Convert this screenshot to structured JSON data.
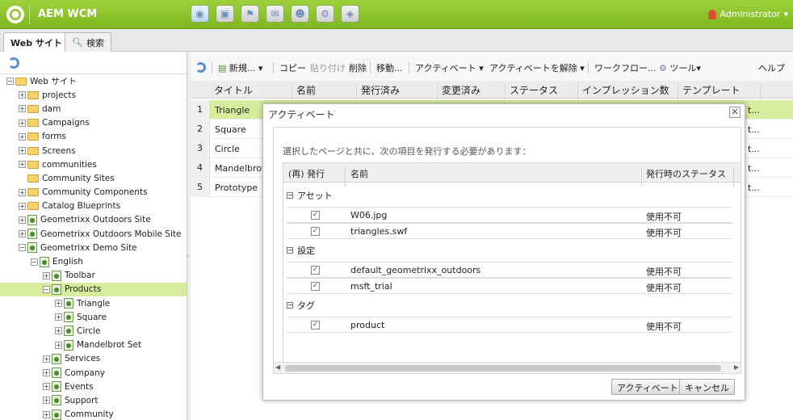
{
  "app": {
    "title": "AEM WCM",
    "user": "Administrator"
  },
  "nav_icons": [
    "websites-icon",
    "assets-icon",
    "campaigns-icon",
    "inbox-icon",
    "users-icon",
    "tools-icon",
    "tagging-icon"
  ],
  "tabs": [
    {
      "label": "Web サイト"
    },
    {
      "label": "検索"
    }
  ],
  "tree": [
    {
      "label": "Web サイト",
      "indent": 0,
      "exp": "−",
      "icon": "folder"
    },
    {
      "label": "projects",
      "indent": 1,
      "exp": "+",
      "icon": "folder"
    },
    {
      "label": "dam",
      "indent": 1,
      "exp": "+",
      "icon": "folder"
    },
    {
      "label": "Campaigns",
      "indent": 1,
      "exp": "+",
      "icon": "folder"
    },
    {
      "label": "forms",
      "indent": 1,
      "exp": "+",
      "icon": "folder"
    },
    {
      "label": "Screens",
      "indent": 1,
      "exp": "+",
      "icon": "folder"
    },
    {
      "label": "communities",
      "indent": 1,
      "exp": "+",
      "icon": "folder"
    },
    {
      "label": "Community Sites",
      "indent": 1,
      "exp": "",
      "icon": "folder"
    },
    {
      "label": "Community Components",
      "indent": 1,
      "exp": "+",
      "icon": "folder"
    },
    {
      "label": "Catalog Blueprints",
      "indent": 1,
      "exp": "+",
      "icon": "folder"
    },
    {
      "label": "Geometrixx Outdoors Site",
      "indent": 1,
      "exp": "+",
      "icon": "page"
    },
    {
      "label": "Geometrixx Outdoors Mobile Site",
      "indent": 1,
      "exp": "+",
      "icon": "page"
    },
    {
      "label": "Geometrixx Demo Site",
      "indent": 1,
      "exp": "−",
      "icon": "page"
    },
    {
      "label": "English",
      "indent": 2,
      "exp": "−",
      "icon": "page"
    },
    {
      "label": "Toolbar",
      "indent": 3,
      "exp": "+",
      "icon": "page"
    },
    {
      "label": "Products",
      "indent": 3,
      "exp": "−",
      "icon": "page",
      "selected": true
    },
    {
      "label": "Triangle",
      "indent": 4,
      "exp": "+",
      "icon": "page"
    },
    {
      "label": "Square",
      "indent": 4,
      "exp": "+",
      "icon": "page"
    },
    {
      "label": "Circle",
      "indent": 4,
      "exp": "+",
      "icon": "page"
    },
    {
      "label": "Mandelbrot Set",
      "indent": 4,
      "exp": "+",
      "icon": "page"
    },
    {
      "label": "Services",
      "indent": 3,
      "exp": "+",
      "icon": "page"
    },
    {
      "label": "Company",
      "indent": 3,
      "exp": "+",
      "icon": "page"
    },
    {
      "label": "Events",
      "indent": 3,
      "exp": "+",
      "icon": "page"
    },
    {
      "label": "Support",
      "indent": 3,
      "exp": "+",
      "icon": "page"
    },
    {
      "label": "Community",
      "indent": 3,
      "exp": "+",
      "icon": "page"
    }
  ],
  "toolbar": {
    "new": "新規... ▾",
    "copy": "コピー",
    "paste": "貼り付け",
    "delete": "削除",
    "move": "移動...",
    "activate": "アクティベート ▾",
    "deactivate": "アクティベートを解除 ▾",
    "workflow": "ワークフロー...",
    "tools": "ツール▾",
    "help": "ヘルプ"
  },
  "columns": [
    "タイトル",
    "名前",
    "発行済み",
    "変更済み",
    "ステータス",
    "インプレッション数",
    "テンプレート"
  ],
  "rows": [
    {
      "num": "1",
      "title": "Triangle",
      "tail": "t...",
      "selected": true
    },
    {
      "num": "2",
      "title": "Square",
      "tail": "t..."
    },
    {
      "num": "3",
      "title": "Circle",
      "tail": "t..."
    },
    {
      "num": "4",
      "title": "Mandelbrot S",
      "tail": "t..."
    },
    {
      "num": "5",
      "title": "Prototype",
      "tail": "t..."
    }
  ],
  "dialog": {
    "title": "アクティベート",
    "message": "選択したページと共に、次の項目を発行する必要があります：",
    "headers": {
      "republish": "(再) 発行",
      "name": "名前",
      "status": "発行時のステータス"
    },
    "groups": [
      {
        "label": "アセット",
        "items": [
          {
            "name": "W06.jpg",
            "status": "使用不可"
          },
          {
            "name": "triangles.swf",
            "status": "使用不可"
          }
        ]
      },
      {
        "label": "設定",
        "items": [
          {
            "name": "default_geometrixx_outdoors",
            "status": "使用不可"
          },
          {
            "name": "msft_trial",
            "status": "使用不可"
          }
        ]
      },
      {
        "label": "タグ",
        "items": [
          {
            "name": "product",
            "status": "使用不可"
          }
        ]
      }
    ],
    "buttons": {
      "activate": "アクティベート",
      "cancel": "キャンセル"
    }
  }
}
